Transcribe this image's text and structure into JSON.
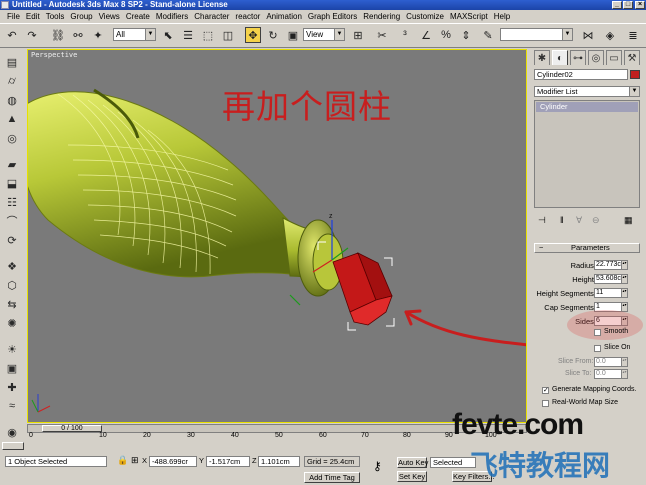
{
  "window": {
    "title": "Untitled - Autodesk 3ds Max 8 SP2 - Stand-alone License"
  },
  "menu": [
    "File",
    "Edit",
    "Tools",
    "Group",
    "Views",
    "Create",
    "Modifiers",
    "Character",
    "reactor",
    "Animation",
    "Graph Editors",
    "Rendering",
    "Customize",
    "MAXScript",
    "Help"
  ],
  "toolbar": {
    "selection_filter": "All",
    "reference_coord": "View"
  },
  "viewport": {
    "label": "Perspective",
    "annotation": "再加个圆柱"
  },
  "command_panel": {
    "object_name": "Cylinder02",
    "object_color": "#c0201e",
    "modifier_list": "Modifier List",
    "stack_items": [
      "Cylinder"
    ],
    "rollout_title": "Parameters",
    "params": [
      {
        "label": "Radius:",
        "value": "22.773cm"
      },
      {
        "label": "Height:",
        "value": "53.608cm"
      },
      {
        "label": "Height Segments:",
        "value": "11"
      },
      {
        "label": "Cap Segments:",
        "value": "1"
      },
      {
        "label": "Sides:",
        "value": "6"
      }
    ],
    "smooth_label": "Smooth",
    "slice_on_label": "Slice On",
    "slice_from_label": "Slice From:",
    "slice_from_value": "0.0",
    "slice_to_label": "Slice To:",
    "slice_to_value": "0.0",
    "gen_mapping_label": "Generate Mapping Coords.",
    "realworld_label": "Real-World Map Size"
  },
  "timeline": {
    "slider_text": "0 / 100",
    "ticks": [
      "0",
      "10",
      "20",
      "30",
      "40",
      "50",
      "60",
      "70",
      "80",
      "90",
      "100"
    ]
  },
  "status": {
    "selection": "1 Object Selected",
    "x_label": "X",
    "x_value": "-488.699cr",
    "y_label": "Y",
    "y_value": "-1.517cm",
    "z_label": "Z",
    "z_value": "1.101cm",
    "grid": "Grid = 25.4cm",
    "add_time_tag": "Add Time Tag",
    "auto_key": "Auto Key",
    "auto_key_value": "Selected",
    "set_key": "Set Key",
    "key_filters": "Key Filters..."
  },
  "watermark": {
    "line1": "fevte.com",
    "line2": "飞特教程网"
  }
}
